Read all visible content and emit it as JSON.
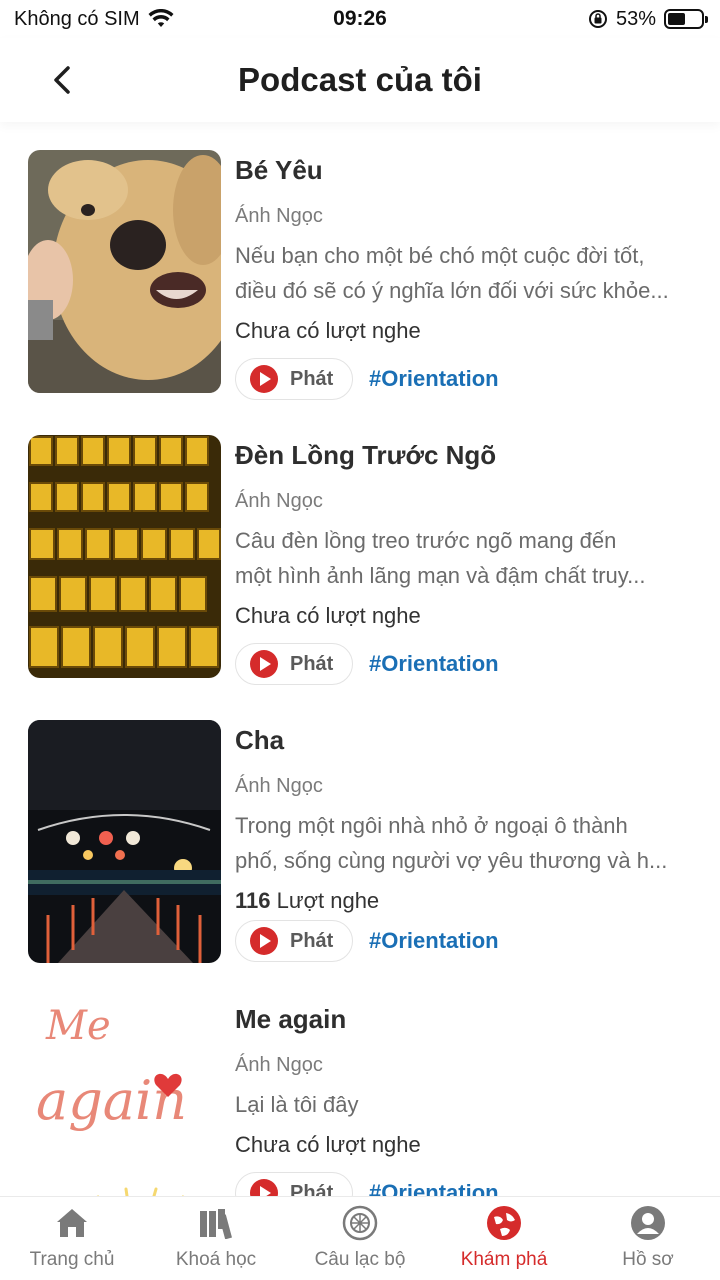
{
  "status_bar": {
    "carrier": "Không có SIM",
    "time": "09:26",
    "battery": "53%",
    "battery_level": 0.53
  },
  "header": {
    "title": "Podcast của tôi"
  },
  "podcasts": [
    {
      "title": "Bé Yêu",
      "author": "Ánh Ngọc",
      "desc_line1": "Nếu bạn cho một bé chó một cuộc đời tốt,",
      "desc_line2": "điều đó sẽ có ý nghĩa lớn đối với sức khỏe...",
      "listens_count": "",
      "listens_text": "Chưa có lượt nghe",
      "play_label": "Phát",
      "tag": "#Orientation"
    },
    {
      "title": "Đèn Lồng Trước Ngõ",
      "author": "Ánh Ngọc",
      "desc_line1": "Câu đèn lồng treo trước ngõ mang đến",
      "desc_line2": "một hình ảnh lãng mạn và đậm chất truy...",
      "listens_count": "",
      "listens_text": "Chưa có lượt nghe",
      "play_label": "Phát",
      "tag": "#Orientation"
    },
    {
      "title": "Cha",
      "author": "Ánh Ngọc",
      "desc_line1": "Trong một ngôi nhà nhỏ ở ngoại ô thành",
      "desc_line2": "phố, sống cùng người vợ yêu thương và h...",
      "listens_count": "116",
      "listens_text": " Lượt nghe",
      "play_label": "Phát",
      "tag": "#Orientation"
    },
    {
      "title": "Me again",
      "author": "Ánh Ngọc",
      "desc_line1": "Lại là tôi đây",
      "desc_line2": "",
      "listens_count": "",
      "listens_text": "Chưa có lượt nghe",
      "play_label": "Phát",
      "tag": "#Orientation",
      "thumb_text_1": "Me",
      "thumb_text_2": "again"
    }
  ],
  "tabbar": {
    "tabs": [
      {
        "label": "Trang chủ",
        "icon": "home-icon"
      },
      {
        "label": "Khoá học",
        "icon": "books-icon"
      },
      {
        "label": "Câu lạc bộ",
        "icon": "club-icon"
      },
      {
        "label": "Khám phá",
        "icon": "explore-icon",
        "active": true
      },
      {
        "label": "Hồ sơ",
        "icon": "profile-icon"
      }
    ]
  },
  "colors": {
    "accent": "#d52b2b",
    "tag": "#1a6fb5"
  }
}
